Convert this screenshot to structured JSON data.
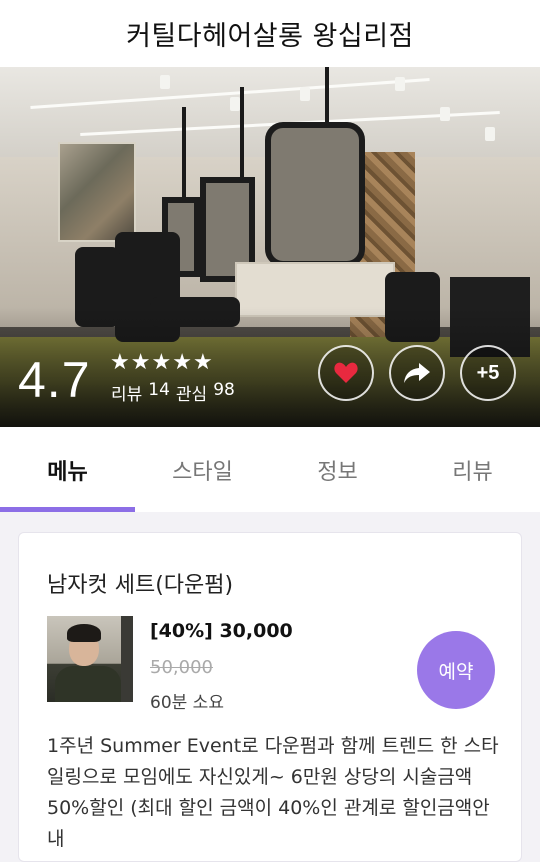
{
  "header": {
    "title": "커틸다헤어살롱 왕십리점"
  },
  "hero": {
    "rating": "4.7",
    "stars": [
      "★",
      "★",
      "★",
      "★",
      "★"
    ],
    "review_label": "리뷰",
    "review_count": "14",
    "interest_label": "관심",
    "interest_count": "98",
    "more_label": "+5",
    "heart_color": "#e8293f"
  },
  "tabs": [
    {
      "label": "메뉴",
      "active": true
    },
    {
      "label": "스타일",
      "active": false
    },
    {
      "label": "정보",
      "active": false
    },
    {
      "label": "리뷰",
      "active": false
    }
  ],
  "menu_item": {
    "title": "남자컷 세트(다운펌)",
    "discount_price": "[40%] 30,000",
    "original_price": "50,000",
    "duration": "60분 소요",
    "book_label": "예약",
    "description": "1주년 Summer Event로 다운펌과 함께 트렌드 한 스타일링으로 모임에도 자신있게~ 6만원 상당의 시술금액 50%할인 (최대 할인 금액이 40%인 관계로 할인금액안내"
  },
  "colors": {
    "accent": "#8c6ee6",
    "book_button": "#9a78e8"
  }
}
